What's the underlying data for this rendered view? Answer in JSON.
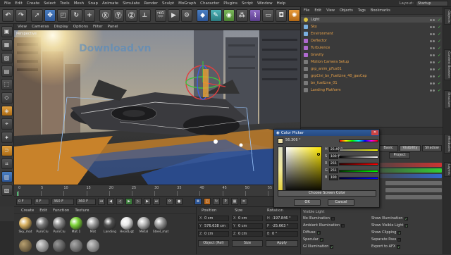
{
  "menubar": {
    "items": [
      "File",
      "Edit",
      "Create",
      "Select",
      "Tools",
      "Mesh",
      "Snap",
      "Animate",
      "Simulate",
      "Render",
      "Sculpt",
      "MoGraph",
      "Character",
      "Plugins",
      "Script",
      "Window",
      "Help"
    ],
    "layout_label": "Layout:",
    "layout_value": "Startup"
  },
  "toolbar": {
    "icons": [
      "undo",
      "redo",
      "move",
      "scale",
      "rotate",
      "x-axis",
      "y-axis",
      "z-axis",
      "coord",
      "render-view",
      "render-settings",
      "render-pv",
      "cube",
      "pen",
      "subdivide",
      "array",
      "deformer",
      "floor",
      "camera",
      "light"
    ]
  },
  "viewport": {
    "menu": [
      "View",
      "Cameras",
      "Display",
      "Options",
      "Filter",
      "Panel"
    ],
    "label": "Perspective",
    "watermark": "Download.vn"
  },
  "timeline": {
    "ticks": [
      "0",
      "5",
      "10",
      "15",
      "20",
      "25",
      "30",
      "35",
      "40",
      "45",
      "50",
      "55",
      "60"
    ],
    "frame_end": "0 F"
  },
  "playback": {
    "start": "0 F",
    "current": "0 F",
    "end": "360 F",
    "max": "360 F"
  },
  "materials": {
    "menu": [
      "Create",
      "Edit",
      "Function",
      "Texture"
    ],
    "items": [
      {
        "label": "Sky_mat",
        "color": "#d8b060"
      },
      {
        "label": "PyroClu",
        "color": "#7a7a7a"
      },
      {
        "label": "PyroClu",
        "color": "#8c8c8c"
      },
      {
        "label": "Mat.1",
        "color": "#7ed43a"
      },
      {
        "label": "Mat",
        "color": "#a0a0a0"
      },
      {
        "label": "Landing",
        "color": "#505050"
      },
      {
        "label": "HeadLigt",
        "color": "#e8e8e8"
      },
      {
        "label": "Metal",
        "color": "#b8b8b8"
      },
      {
        "label": "Steel_mat",
        "color": "#9a9a9a"
      }
    ]
  },
  "coords": {
    "headers": {
      "position": "Position",
      "size": "Size",
      "rotation": "Rotation"
    },
    "pos": {
      "x": "0 cm",
      "y": "576.638 cm",
      "z": "0 cm"
    },
    "size": {
      "x": "0 cm",
      "y": "0 cm",
      "z": "0 cm"
    },
    "rot": {
      "h": "-197.846 °",
      "p": "-25.663 °",
      "b": "0 °"
    },
    "mode": "Object (Rel)",
    "size_mode": "Size",
    "apply": "Apply"
  },
  "objmgr": {
    "menu": [
      "File",
      "Edit",
      "View",
      "Objects",
      "Tags",
      "Bookmarks"
    ],
    "objects": [
      {
        "name": "Light",
        "kind": "bulb",
        "color": "white"
      },
      {
        "name": "Sky",
        "kind": "star",
        "color": "orange"
      },
      {
        "name": "Environment",
        "kind": "star",
        "color": "orange"
      },
      {
        "name": "Deflector",
        "kind": "field",
        "color": "orange"
      },
      {
        "name": "Turbulence",
        "kind": "field",
        "color": "orange"
      },
      {
        "name": "Gravity",
        "kind": "field",
        "color": "orange"
      },
      {
        "name": "Motion Camera Setup",
        "kind": "null",
        "color": "orange"
      },
      {
        "name": "grp_anim_pFus01",
        "kind": "null",
        "color": "orange"
      },
      {
        "name": "grpCivi_bn_FuelLine_40_gasCap",
        "kind": "null",
        "color": "orange"
      },
      {
        "name": "bn_fuelLine_01",
        "kind": "null",
        "color": "orange"
      },
      {
        "name": "Landing Platform",
        "kind": "null",
        "color": "orange"
      }
    ]
  },
  "attrmgr": {
    "menu": [
      "Mode",
      "Edit",
      "User Data"
    ],
    "tabs": [
      "Basic",
      "Visibility",
      "Shadow",
      "Project"
    ],
    "checks": [
      {
        "label": "No Illumination",
        "checked": false
      },
      {
        "label": "Ambient Illumination",
        "checked": false
      },
      {
        "label": "Diffuse",
        "checked": true
      },
      {
        "label": "Specular",
        "checked": true
      },
      {
        "label": "GI Illumination",
        "checked": true
      },
      {
        "label": "Show Illumination",
        "checked": true
      },
      {
        "label": "Show Visible Light",
        "checked": true
      },
      {
        "label": "Show Clipping",
        "checked": true
      },
      {
        "label": "Separate Pass",
        "checked": false
      },
      {
        "label": "Export to AFX",
        "checked": true
      }
    ],
    "visible_light_label": "Visible Light"
  },
  "colorpicker": {
    "title": "Color Picker",
    "hex": "56.306 °",
    "h": "25.49 %",
    "s": "100 %",
    "r": "255",
    "g": "251",
    "b": "190",
    "h_label": "H",
    "s_label": "S",
    "r_label": "R",
    "g_label": "G",
    "b_label": "B",
    "screen_color": "Choose Screen Color",
    "ok": "OK",
    "cancel": "Cancel"
  },
  "sidetabs": [
    "Objects",
    "Content Browser",
    "Structure",
    "Attributes",
    "Layers"
  ]
}
